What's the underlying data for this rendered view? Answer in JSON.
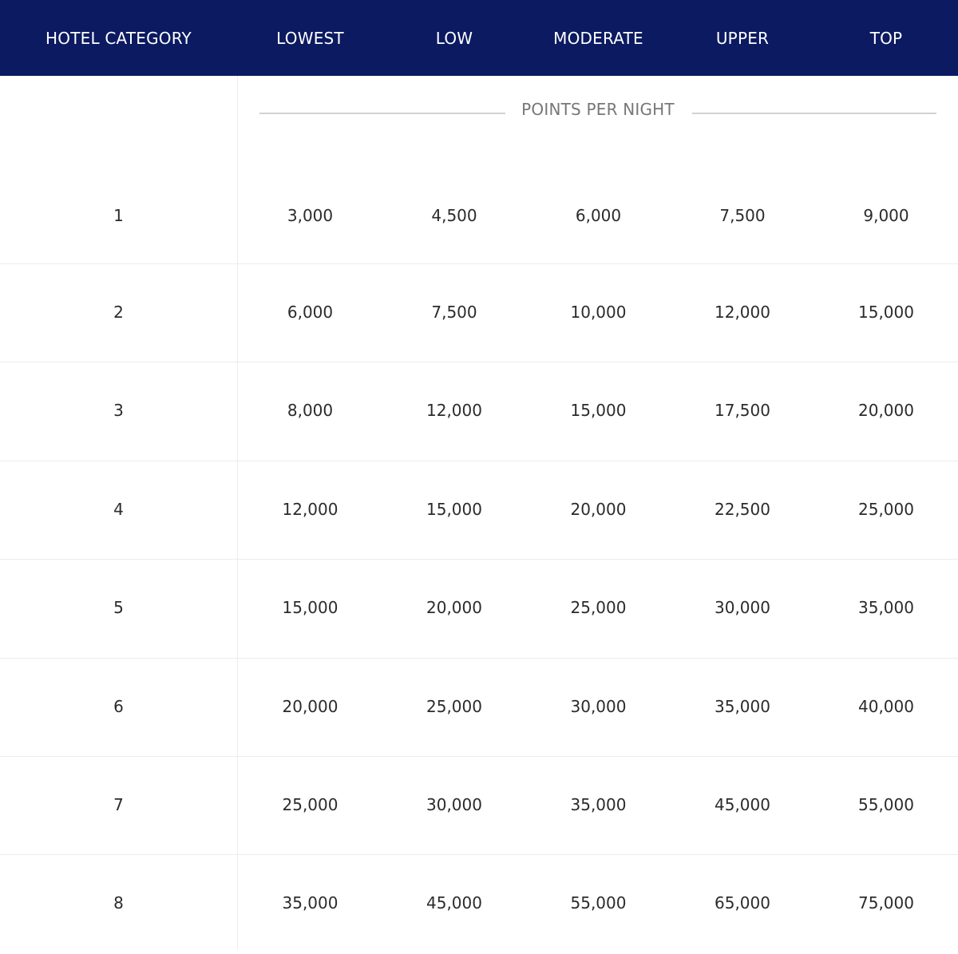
{
  "table": {
    "columns": [
      "HOTEL CATEGORY",
      "LOWEST",
      "LOW",
      "MODERATE",
      "UPPER",
      "TOP"
    ],
    "subheader": "POINTS PER NIGHT",
    "rows": [
      [
        "1",
        "3,000",
        "4,500",
        "6,000",
        "7,500",
        "9,000"
      ],
      [
        "2",
        "6,000",
        "7,500",
        "10,000",
        "12,000",
        "15,000"
      ],
      [
        "3",
        "8,000",
        "12,000",
        "15,000",
        "17,500",
        "20,000"
      ],
      [
        "4",
        "12,000",
        "15,000",
        "20,000",
        "22,500",
        "25,000"
      ],
      [
        "5",
        "15,000",
        "20,000",
        "25,000",
        "30,000",
        "35,000"
      ],
      [
        "6",
        "20,000",
        "25,000",
        "30,000",
        "35,000",
        "40,000"
      ],
      [
        "7",
        "25,000",
        "30,000",
        "35,000",
        "45,000",
        "55,000"
      ],
      [
        "8",
        "35,000",
        "45,000",
        "55,000",
        "65,000",
        "75,000"
      ]
    ]
  },
  "colors": {
    "header_bg": "#0c1a61",
    "header_text": "#ffffff",
    "grid_line": "#ececec"
  }
}
